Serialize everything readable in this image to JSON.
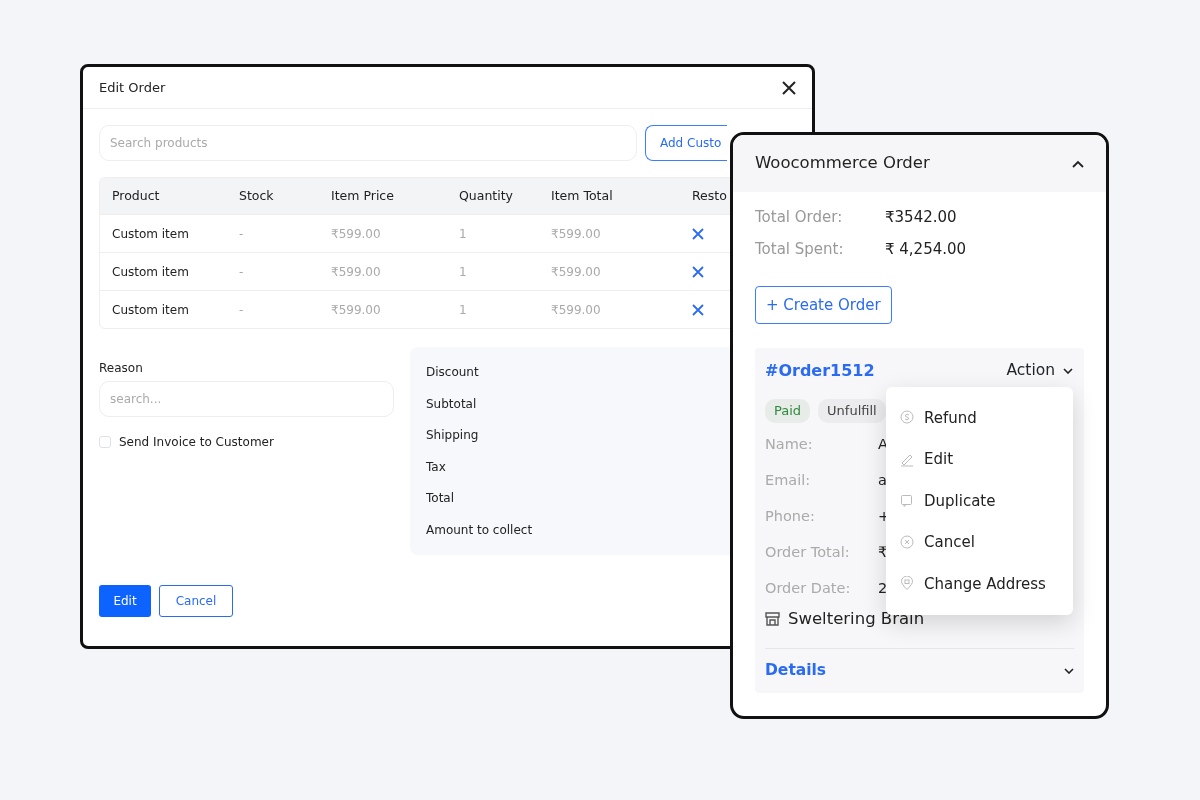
{
  "edit_order": {
    "title": "Edit Order",
    "search": {
      "placeholder": "Search products"
    },
    "add_button": "Add Custo",
    "table": {
      "columns": [
        "Product",
        "Stock",
        "Item Price",
        "Quantity",
        "Item Total",
        "Resto"
      ],
      "rows": [
        {
          "product": "Custom item",
          "stock": "-",
          "price": "₹599.00",
          "quantity": "1",
          "total": "₹599.00"
        },
        {
          "product": "Custom item",
          "stock": "-",
          "price": "₹599.00",
          "quantity": "1",
          "total": "₹599.00"
        },
        {
          "product": "Custom item",
          "stock": "-",
          "price": "₹599.00",
          "quantity": "1",
          "total": "₹599.00"
        }
      ]
    },
    "reason": {
      "label": "Reason",
      "placeholder": "search..."
    },
    "send_invoice": {
      "label": "Send Invoice to Customer",
      "checked": false
    },
    "summary": [
      "Discount",
      "Subtotal",
      "Shipping",
      "Tax",
      "Total",
      "Amount to collect"
    ],
    "buttons": [
      {
        "label": "Edit",
        "kind": "primary"
      },
      {
        "label": "Cancel",
        "kind": "outline"
      }
    ]
  },
  "woo_panel": {
    "title": "Woocommerce Order",
    "expanded": true,
    "totals": [
      {
        "label": "Total Order:",
        "value": "₹3542.00"
      },
      {
        "label": "Total Spent:",
        "value": "₹ 4,254.00"
      }
    ],
    "create_button": "+ Create Order",
    "order": {
      "number": "#Order1512",
      "action": "Action",
      "tags": [
        {
          "label": "Paid",
          "kind": "paid"
        },
        {
          "label": "Unfulfill",
          "kind": "plain"
        }
      ],
      "fields": [
        {
          "label": "Name:",
          "value": "A"
        },
        {
          "label": "Email:",
          "value": "a"
        },
        {
          "label": "Phone:",
          "value": "+"
        },
        {
          "label": "Order Total:",
          "value": "₹"
        },
        {
          "label": "Order Date:",
          "value": "2"
        }
      ],
      "store": "Sweltering Brain",
      "details": "Details"
    },
    "menu": [
      {
        "label": "Refund",
        "kind": "refund"
      },
      {
        "label": "Edit",
        "kind": "edit"
      },
      {
        "label": "Duplicate",
        "kind": "duplicate"
      },
      {
        "label": "Cancel",
        "kind": "cancel"
      },
      {
        "label": "Change Address",
        "kind": "address"
      }
    ]
  }
}
